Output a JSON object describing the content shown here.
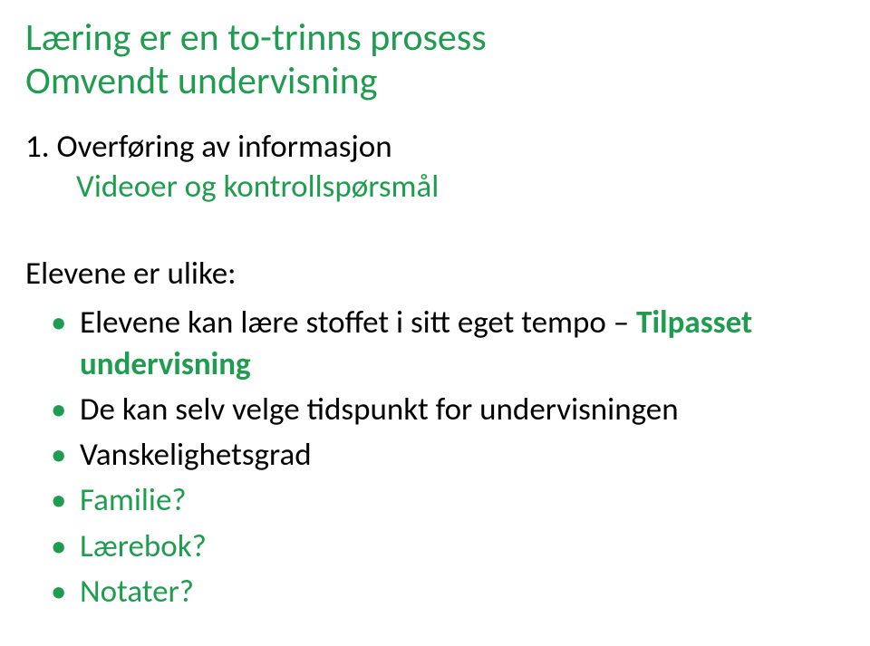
{
  "title": {
    "line1": "Læring er en to-trinns prosess",
    "line2": "Omvendt undervisning"
  },
  "ordered": {
    "num": "1.",
    "head": "Overføring av informasjon",
    "sub": "Videoer og kontrollspørsmål"
  },
  "section": "Elevene er ulike:",
  "bullets": {
    "b1_plain": "Elevene kan lære stoffet i sitt eget tempo – ",
    "b1_bold": "Tilpasset undervisning",
    "b2": "De kan selv velge tidspunkt for undervisningen",
    "b3": "Vanskelighetsgrad",
    "b4": "Familie?",
    "b5": "Lærebok?",
    "b6": "Notater?"
  }
}
